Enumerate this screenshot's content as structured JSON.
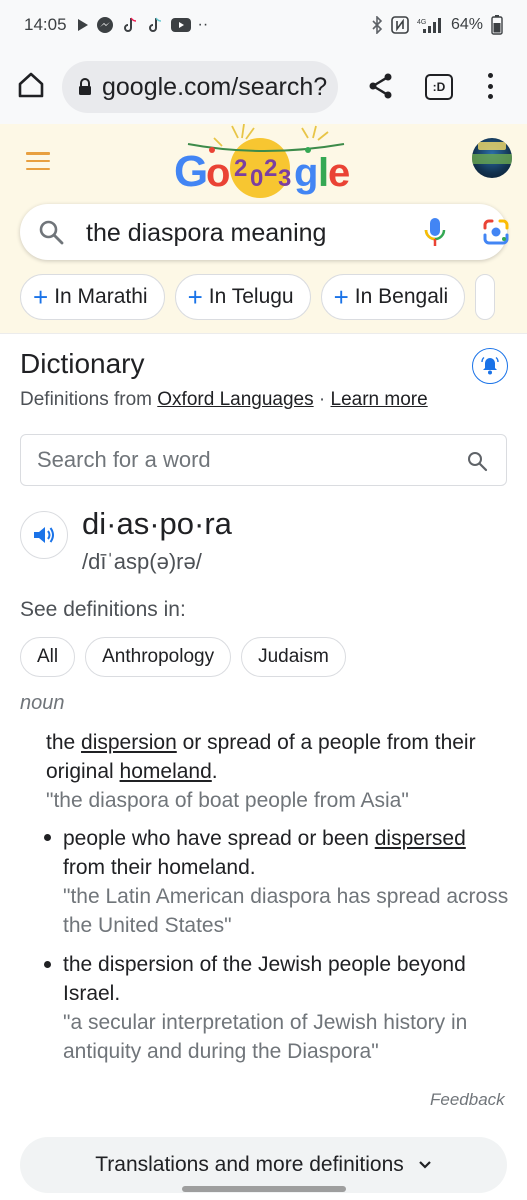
{
  "status_bar": {
    "time": "14:05",
    "battery": "64%",
    "left_icons": [
      "play-icon",
      "messenger-icon",
      "tiktok-icon",
      "tiktok-icon",
      "youtube-icon",
      "more-dots"
    ],
    "right_icons": [
      "bluetooth-icon",
      "nfc-icon",
      "4g-signal-icon",
      "battery-icon"
    ]
  },
  "browser": {
    "url": "google.com/search?",
    "tabs_label": ":D"
  },
  "google": {
    "search_query": "the diaspora meaning",
    "chips": [
      {
        "label": "In Marathi"
      },
      {
        "label": "In Telugu"
      },
      {
        "label": "In Bengali"
      }
    ]
  },
  "dictionary": {
    "title": "Dictionary",
    "source_prefix": "Definitions from ",
    "source_link": "Oxford Languages",
    "separator": " · ",
    "learn_more": "Learn more",
    "search_placeholder": "Search for a word",
    "headword": "di·as·po·ra",
    "phonetic": "/dīˈasp(ə)rə/",
    "see_definitions_label": "See definitions in:",
    "definition_chips": [
      "All",
      "Anthropology",
      "Judaism"
    ],
    "part_of_speech": "noun",
    "definitions": [
      {
        "text_parts": [
          "the ",
          "dispersion",
          " or spread of a people from their original ",
          "homeland",
          "."
        ],
        "example": "\"the diaspora of boat people from Asia\""
      },
      {
        "text_parts": [
          "people who have spread or been ",
          "dispersed",
          " from their homeland."
        ],
        "example": "\"the Latin American diaspora has spread across the United States\""
      },
      {
        "text": "the dispersion of the Jewish people beyond Israel.",
        "example": "\"a secular interpretation of Jewish history in antiquity and during the Diaspora\""
      }
    ],
    "feedback": "Feedback",
    "more_button": "Translations and more definitions"
  },
  "colors": {
    "accent_blue": "#1a73e8",
    "doodle_bg": "#fdf8e6",
    "status_bg": "#f8f9fa"
  }
}
